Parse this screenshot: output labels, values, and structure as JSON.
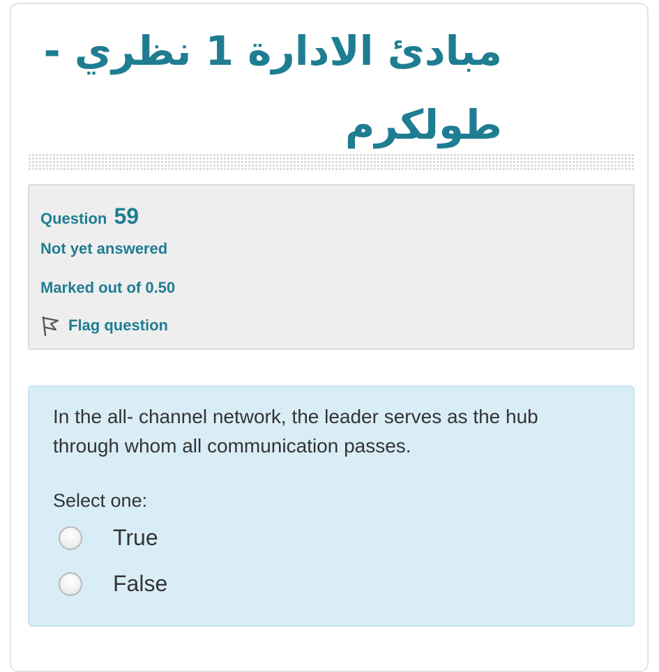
{
  "course": {
    "title": "مبادئ الادارة 1 نظري - طولكرم"
  },
  "question_info": {
    "label": "Question",
    "number": "59",
    "status": "Not yet answered",
    "mark": "Marked out of 0.50",
    "flag_label": "Flag question"
  },
  "question": {
    "text": "In the all- channel network, the leader serves as the hub through whom all communication passes.",
    "select_label": "Select one:",
    "options": [
      {
        "label": "True",
        "selected": false
      },
      {
        "label": "False",
        "selected": false
      }
    ]
  },
  "colors": {
    "accent": "#1f7d92",
    "info_bg": "#eeeeee",
    "question_bg": "#d9edf7",
    "text": "#333333"
  }
}
